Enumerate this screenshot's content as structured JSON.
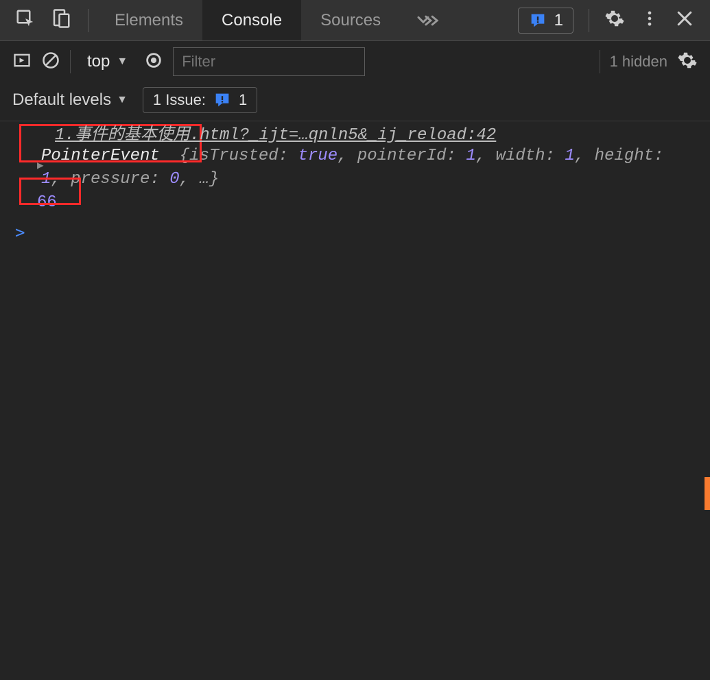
{
  "tabs": {
    "elements": "Elements",
    "console": "Console",
    "sources": "Sources",
    "active": "console"
  },
  "topbar": {
    "issues_count": "1"
  },
  "toolbar": {
    "context_label": "top",
    "filter_placeholder": "Filter",
    "hidden_label": "1 hidden"
  },
  "levels": {
    "label": "Default levels",
    "issue_prefix": "1 Issue:",
    "issue_count": "1"
  },
  "console": {
    "source_link": "1.事件的基本使用.html?_ijt=…qnln5&_ij_reload:42",
    "class_name": "PointerEvent",
    "props": {
      "isTrusted_key": "isTrusted",
      "isTrusted_val": "true",
      "pointerId_key": "pointerId",
      "pointerId_val": "1",
      "width_key": "width",
      "width_val": "1",
      "height_key": "height",
      "height_val": "1",
      "pressure_key": "pressure",
      "pressure_val": "0"
    },
    "second_output": "66",
    "prompt": ">"
  }
}
